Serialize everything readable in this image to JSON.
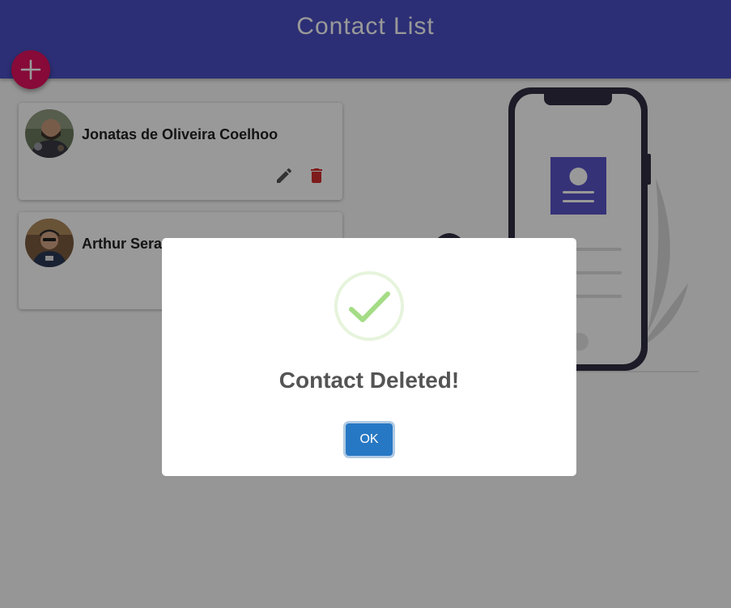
{
  "appbar": {
    "title": "Contact List"
  },
  "fab": {
    "icon": "plus-icon",
    "color": "#e2115e"
  },
  "contacts": [
    {
      "name": "Jonatas de Oliveira Coelhoo",
      "avatar": "avatar-photo"
    },
    {
      "name": "Arthur Sera",
      "avatar": "avatar-photo"
    }
  ],
  "card_actions": {
    "edit_icon": "pencil-icon",
    "delete_icon": "trash-icon",
    "delete_color": "#d32f2f"
  },
  "dialog": {
    "icon": "checkmark-icon",
    "title": "Contact Deleted!",
    "confirm_label": "OK"
  },
  "colors": {
    "appbar": "#4a4fc3",
    "accent": "#5b54c9",
    "ok_button": "#2778c4",
    "success": "#a5dc86"
  }
}
